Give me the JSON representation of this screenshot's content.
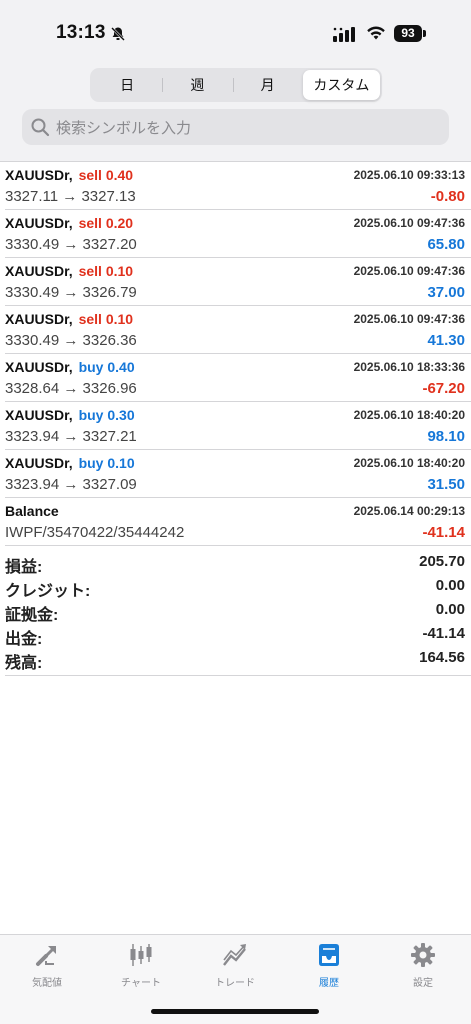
{
  "status_bar": {
    "time": "13:13",
    "battery": "93"
  },
  "segments": [
    {
      "label": "日"
    },
    {
      "label": "週"
    },
    {
      "label": "月"
    },
    {
      "label": "カスタム"
    }
  ],
  "search": {
    "placeholder": "検索シンボルを入力"
  },
  "trades": [
    {
      "symbol": "XAUUSDr,",
      "type": "sell 0.40",
      "side": "sell",
      "datetime": "2025.06.10 09:33:13",
      "prices": "3327.11 → 3327.13",
      "profit": "-0.80"
    },
    {
      "symbol": "XAUUSDr,",
      "type": "sell 0.20",
      "side": "sell",
      "datetime": "2025.06.10 09:47:36",
      "prices": "3330.49 → 3327.20",
      "profit": "65.80"
    },
    {
      "symbol": "XAUUSDr,",
      "type": "sell 0.10",
      "side": "sell",
      "datetime": "2025.06.10 09:47:36",
      "prices": "3330.49 → 3326.79",
      "profit": "37.00"
    },
    {
      "symbol": "XAUUSDr,",
      "type": "sell 0.10",
      "side": "sell",
      "datetime": "2025.06.10 09:47:36",
      "prices": "3330.49 → 3326.36",
      "profit": "41.30"
    },
    {
      "symbol": "XAUUSDr,",
      "type": "buy 0.40",
      "side": "buy",
      "datetime": "2025.06.10 18:33:36",
      "prices": "3328.64 → 3326.96",
      "profit": "-67.20"
    },
    {
      "symbol": "XAUUSDr,",
      "type": "buy 0.30",
      "side": "buy",
      "datetime": "2025.06.10 18:40:20",
      "prices": "3323.94 → 3327.21",
      "profit": "98.10"
    },
    {
      "symbol": "XAUUSDr,",
      "type": "buy 0.10",
      "side": "buy",
      "datetime": "2025.06.10 18:40:20",
      "prices": "3323.94 → 3327.09",
      "profit": "31.50"
    }
  ],
  "balance": {
    "title": "Balance",
    "datetime": "2025.06.14 00:29:13",
    "comment": "IWPF/35470422/35444242",
    "amount": "-41.14"
  },
  "summary": [
    {
      "label": "損益:",
      "value": "205.70"
    },
    {
      "label": "クレジット:",
      "value": "0.00"
    },
    {
      "label": "証拠金:",
      "value": "0.00"
    },
    {
      "label": "出金:",
      "value": "-41.14"
    },
    {
      "label": "残高:",
      "value": "164.56"
    }
  ],
  "tabs": [
    {
      "label": "気配値",
      "icon": "quotes-icon"
    },
    {
      "label": "チャート",
      "icon": "chart-icon"
    },
    {
      "label": "トレード",
      "icon": "trade-icon"
    },
    {
      "label": "履歴",
      "icon": "history-icon"
    },
    {
      "label": "設定",
      "icon": "settings-icon"
    }
  ],
  "colors": {
    "sell": "#e0311d",
    "buy": "#1677d8",
    "active_tab": "#1a7fd8",
    "inactive_tab": "#8a8a8e"
  }
}
